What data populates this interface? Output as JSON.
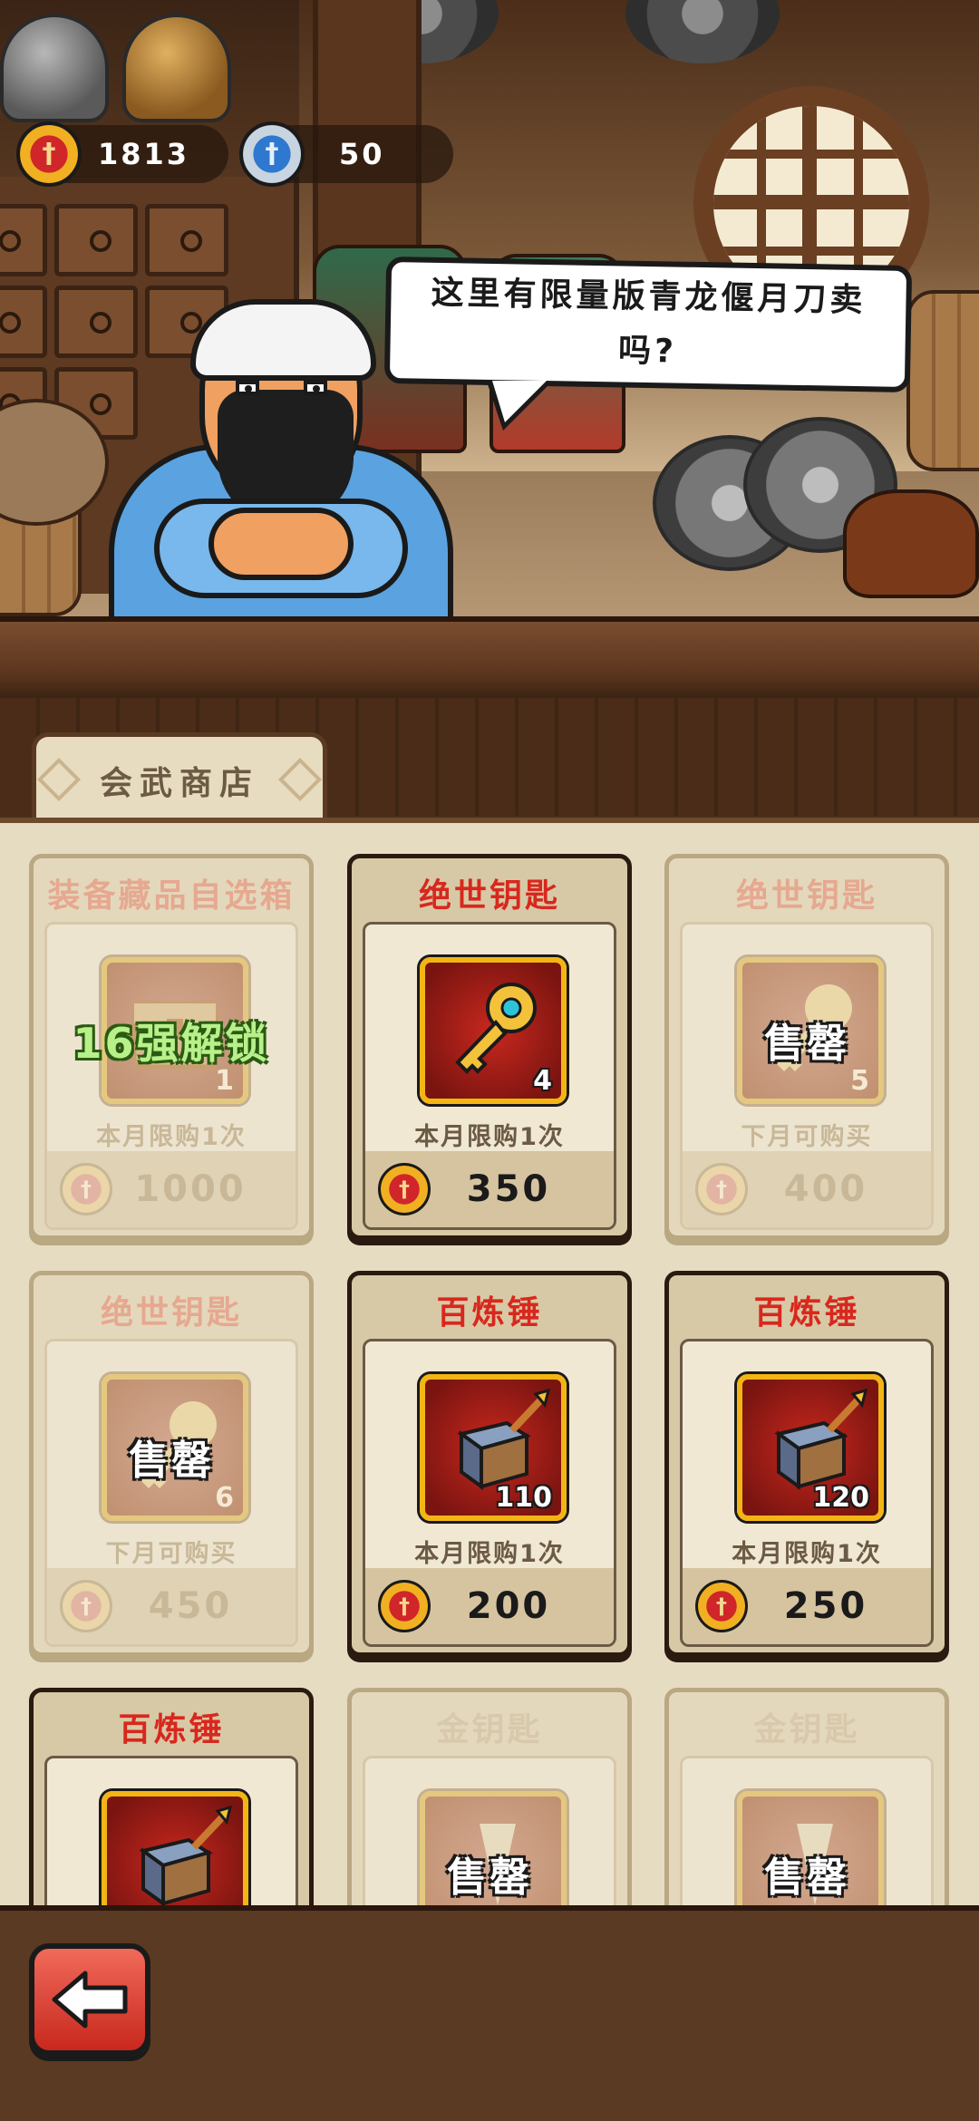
{
  "currencies": [
    {
      "name": "red-token",
      "amount": "1813"
    },
    {
      "name": "blue-token",
      "amount": "50"
    }
  ],
  "dialogue": "这里有限量版青龙偃月刀卖吗?",
  "shop_tab": "会武商店",
  "items": [
    {
      "title": "装备藏品自选箱",
      "qty": "1",
      "limit": "本月限购1次",
      "price": "1000",
      "overlay": "16强解锁",
      "state": "locked",
      "icon": "chest-icon"
    },
    {
      "title": "绝世钥匙",
      "qty": "4",
      "limit": "本月限购1次",
      "price": "350",
      "overlay": "",
      "state": "available",
      "icon": "golden-key-icon"
    },
    {
      "title": "绝世钥匙",
      "qty": "5",
      "limit": "下月可购买",
      "price": "400",
      "overlay": "售罄",
      "state": "sold-out",
      "icon": "golden-key-icon"
    },
    {
      "title": "绝世钥匙",
      "qty": "6",
      "limit": "下月可购买",
      "price": "450",
      "overlay": "售罄",
      "state": "sold-out",
      "icon": "golden-key-icon"
    },
    {
      "title": "百炼锤",
      "qty": "110",
      "limit": "本月限购1次",
      "price": "200",
      "overlay": "",
      "state": "available",
      "icon": "hammer-icon"
    },
    {
      "title": "百炼锤",
      "qty": "120",
      "limit": "本月限购1次",
      "price": "250",
      "overlay": "",
      "state": "available",
      "icon": "hammer-icon"
    },
    {
      "title": "百炼锤",
      "qty": "",
      "limit": "",
      "price": "",
      "overlay": "",
      "state": "available",
      "icon": "hammer-icon"
    },
    {
      "title": "金钥匙",
      "qty": "",
      "limit": "",
      "price": "",
      "overlay": "售罄",
      "state": "sold-out",
      "icon": "gold-key-icon"
    },
    {
      "title": "金钥匙",
      "qty": "",
      "limit": "",
      "price": "",
      "overlay": "售罄",
      "state": "sold-out",
      "icon": "gold-key-icon"
    }
  ],
  "colors": {
    "accent_red": "#d8281e",
    "unlock_green": "#b8f08a",
    "frame_gold": "#f2b514"
  }
}
